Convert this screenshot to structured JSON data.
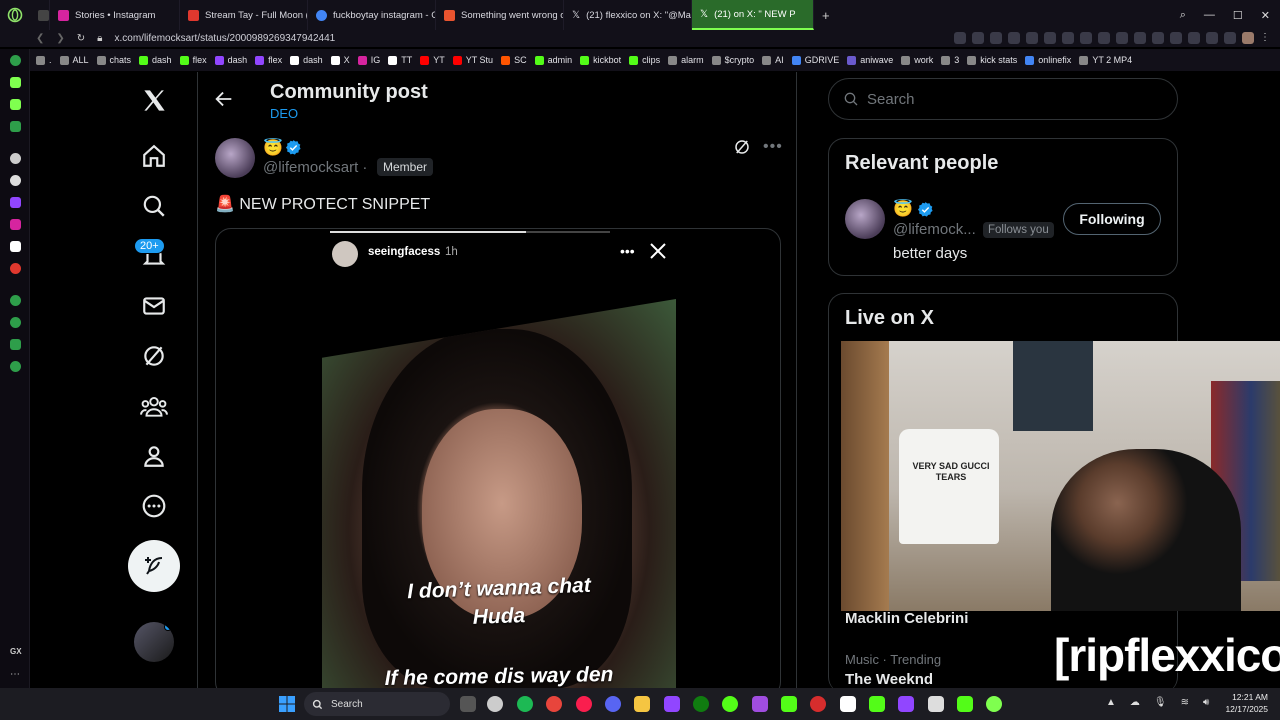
{
  "browser": {
    "tabs": [
      {
        "label": "Stories • Instagram",
        "color": "#d6249f",
        "active": false
      },
      {
        "label": "Stream Tay - Full Moon (f",
        "color": "#e0382e",
        "active": false
      },
      {
        "label": "fuckboytay instagram - G",
        "color": "#4285f4",
        "active": false
      },
      {
        "label": "Something went wrong o",
        "color": "#e9542f",
        "active": false
      },
      {
        "label": "(21) flexxico on X: \"@Ma",
        "color": "#ffffff",
        "active": false
      },
      {
        "label": "(21) on X: \" NEW P",
        "color": "#ffffff",
        "active": true
      }
    ],
    "url": "x.com/lifemocksart/status/2000989269347942441",
    "bookmarks": [
      {
        "label": ".",
        "color": "#888"
      },
      {
        "label": "ALL",
        "color": "#888"
      },
      {
        "label": "chats",
        "color": "#888"
      },
      {
        "label": "dash",
        "color": "#53fc18"
      },
      {
        "label": "flex",
        "color": "#53fc18"
      },
      {
        "label": "dash",
        "color": "#9146ff"
      },
      {
        "label": "flex",
        "color": "#9146ff"
      },
      {
        "label": "dash",
        "color": "#ffffff"
      },
      {
        "label": "X",
        "color": "#ffffff"
      },
      {
        "label": "IG",
        "color": "#d6249f"
      },
      {
        "label": "TT",
        "color": "#ffffff"
      },
      {
        "label": "YT",
        "color": "#ff0000"
      },
      {
        "label": "YT Stu",
        "color": "#ff0000"
      },
      {
        "label": "SC",
        "color": "#ff5500"
      },
      {
        "label": "admin",
        "color": "#53fc18"
      },
      {
        "label": "kickbot",
        "color": "#53fc18"
      },
      {
        "label": "clips",
        "color": "#53fc18"
      },
      {
        "label": "alarm",
        "color": "#888"
      },
      {
        "label": "$crypto",
        "color": "#888"
      },
      {
        "label": "AI",
        "color": "#888"
      },
      {
        "label": "GDRIVE",
        "color": "#4285f4"
      },
      {
        "label": "aniwave",
        "color": "#6a5acd"
      },
      {
        "label": "work",
        "color": "#888"
      },
      {
        "label": "3",
        "color": "#888"
      },
      {
        "label": "kick stats",
        "color": "#888"
      },
      {
        "label": "onlinefix",
        "color": "#4285f4"
      },
      {
        "label": "YT 2 MP4",
        "color": "#888"
      }
    ]
  },
  "xnav": {
    "notification_count": "20+"
  },
  "header": {
    "title": "Community post",
    "subtitle": "DEO"
  },
  "post": {
    "author_emoji": "😇",
    "handle": "@lifemocksart ·",
    "role_badge": "Member",
    "text": "🚨 NEW PROTECT SNIPPET",
    "story": {
      "username": "seeingfacess",
      "time": "1h",
      "progress": 0.7,
      "caption_line1": "I don’t wanna chat",
      "caption_line2": "Huda",
      "caption_line3": "If he come dis way den"
    }
  },
  "sidebar": {
    "search_placeholder": "Search",
    "relevant_people": {
      "title": "Relevant people",
      "emoji": "😇",
      "handle": "@lifemock...",
      "follows_you": "Follows you",
      "bio": "better days",
      "button": "Following"
    },
    "live": {
      "title": "Live on X",
      "host_name": "Macklin Celebrini",
      "shirt_text": "VERY SAD GUCCI TEARS",
      "watermark": "[ripflexxico]"
    },
    "trending": {
      "label": "Music · Trending",
      "title": "The Weeknd"
    }
  },
  "taskbar": {
    "search_label": "Search",
    "time": "12:21 AM",
    "date": "12/17/2025"
  },
  "colors": {
    "accent_blue": "#1d9bf0",
    "opera_green": "#7fff4f"
  }
}
